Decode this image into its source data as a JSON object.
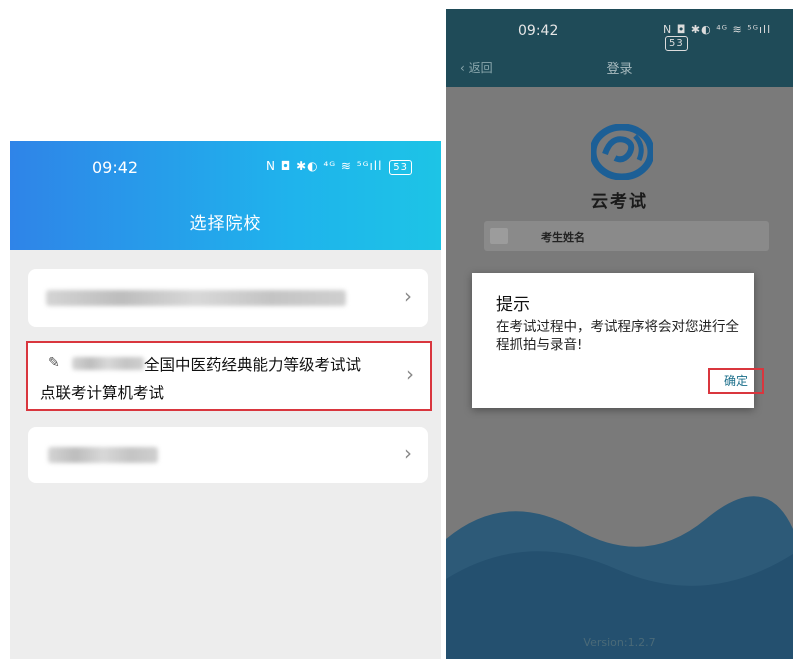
{
  "left": {
    "status_time": "09:42",
    "status_icons": "N ◘ ✱◐ ⁴ᴳ ≋ ⁵ᴳıll",
    "battery": "53",
    "title": "选择院校",
    "schools": [
      {
        "label_line1": "全国中医药经典能力等级考试试",
        "label_line2": "点联考计算机考试"
      }
    ],
    "chevron": "›",
    "edit_icon": "✎"
  },
  "right": {
    "status_time": "09:42",
    "status_icons": "N ◘ ✱◐ ⁴ᴳ ≋ ⁵ᴳıll",
    "battery": "53",
    "back_label": "返回",
    "nav_title": "登录",
    "app_name": "云考试",
    "name_placeholder": "考生姓名",
    "version": "Version:1.2.7",
    "dialog": {
      "title": "提示",
      "message": "在考试过程中，考试程序将会对您进行全程抓拍与录音!",
      "ok_label": "确定"
    },
    "colors": {
      "header_gradient_start": "#2f84e8",
      "header_gradient_end": "#1dc4e6",
      "highlight_border": "#d9363e",
      "logo_blue": "#1f6fb5"
    }
  }
}
